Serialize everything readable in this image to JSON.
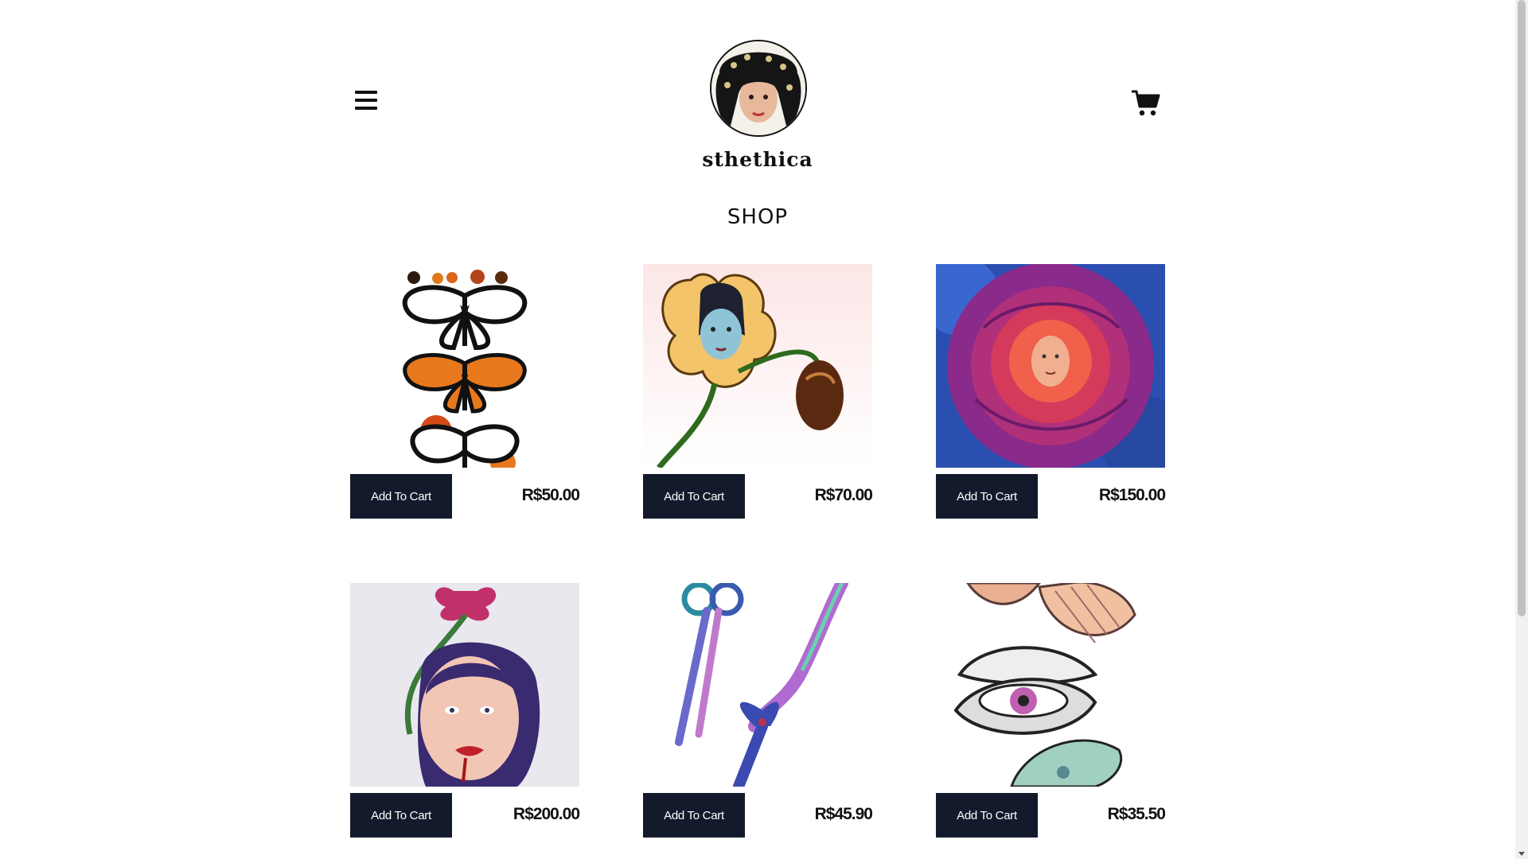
{
  "header": {
    "brand": "sthethica",
    "menu_icon": "hamburger-menu-icon",
    "cart_icon": "shopping-cart-icon",
    "logo": "illustrated-face-logo"
  },
  "page_title": "SHOP",
  "products": [
    {
      "price": "R$50.00",
      "button": "Add To Cart",
      "image": "butterflies-artwork"
    },
    {
      "price": "R$70.00",
      "button": "Add To Cart",
      "image": "flower-face-artwork"
    },
    {
      "price": "R$150.00",
      "button": "Add To Cart",
      "image": "rose-face-artwork"
    },
    {
      "price": "R$200.00",
      "button": "Add To Cart",
      "image": "girl-with-flower-artwork"
    },
    {
      "price": "R$45.90",
      "button": "Add To Cart",
      "image": "scissors-artwork"
    },
    {
      "price": "R$35.50",
      "button": "Add To Cart",
      "image": "shells-and-eye-artwork"
    }
  ],
  "colors": {
    "button_bg": "#131a2b",
    "button_text": "#ffffff",
    "text": "#111111",
    "background": "#ffffff"
  }
}
